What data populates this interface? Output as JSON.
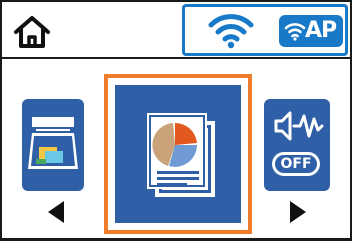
{
  "status": {
    "home_icon": "home-icon",
    "wifi_icon": "wifi-icon",
    "ap_label": "AP"
  },
  "menu": {
    "items": [
      {
        "name": "scan",
        "icon": "scan-icon"
      },
      {
        "name": "copy",
        "icon": "copy-document-icon",
        "selected": true
      },
      {
        "name": "sound",
        "icon": "sound-icon",
        "badge": "OFF"
      }
    ],
    "prev_icon": "triangle-left-icon",
    "next_icon": "triangle-right-icon"
  },
  "colors": {
    "accent_blue": "#1779c7",
    "tile_blue": "#2f5fa6",
    "selection_orange": "#f07d2a",
    "chart_orange": "#e2581f",
    "chart_blue": "#6f9ad3",
    "chart_tan": "#c9a27a"
  }
}
